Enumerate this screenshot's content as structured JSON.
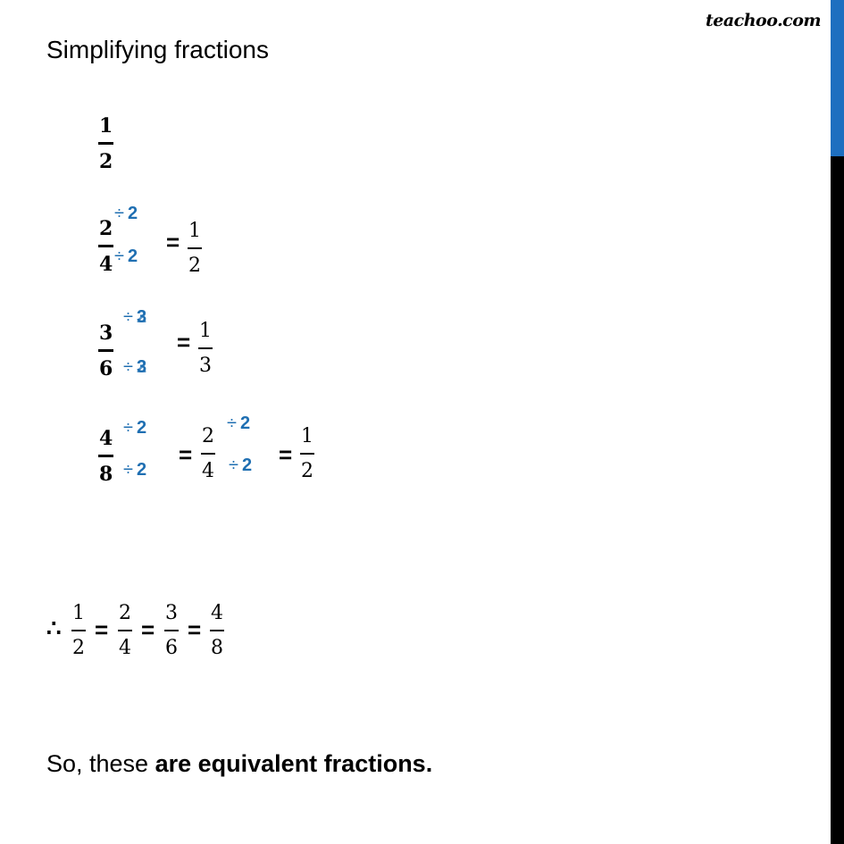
{
  "logo": "teachoo.com",
  "title": "Simplifying fractions",
  "rows": [
    {
      "fraction": {
        "num": "1",
        "den": "2"
      }
    },
    {
      "fraction": {
        "num": "2",
        "den": "4"
      },
      "divisor_top": "2",
      "divisor_bottom": "2",
      "op": "÷",
      "equals": "=",
      "result": {
        "num": "1",
        "den": "2"
      }
    },
    {
      "fraction": {
        "num": "3",
        "den": "6"
      },
      "divisor_top": "3",
      "divisor_top_overlap": "2",
      "divisor_bottom": "3",
      "divisor_bottom_overlap": "2",
      "op": "÷",
      "equals": "=",
      "result": {
        "num": "1",
        "den": "3"
      }
    },
    {
      "fraction": {
        "num": "4",
        "den": "8"
      },
      "divisor_top": "2",
      "divisor_bottom": "2",
      "op": "÷",
      "equals": "=",
      "mid": {
        "num": "2",
        "den": "4"
      },
      "divisor2_top": "2",
      "divisor2_bottom": "2",
      "result": {
        "num": "1",
        "den": "2"
      }
    }
  ],
  "summary": {
    "symbol": "∴",
    "equals": "=",
    "fractions": [
      {
        "num": "1",
        "den": "2"
      },
      {
        "num": "2",
        "den": "4"
      },
      {
        "num": "3",
        "den": "6"
      },
      {
        "num": "4",
        "den": "8"
      }
    ]
  },
  "conclusion": {
    "prefix": "So, these ",
    "bold": "are equivalent fractions."
  },
  "colors": {
    "divisor": "#1f6fb2",
    "scrollbar_thumb": "#1e6fc0",
    "scrollbar_track": "#000000"
  }
}
